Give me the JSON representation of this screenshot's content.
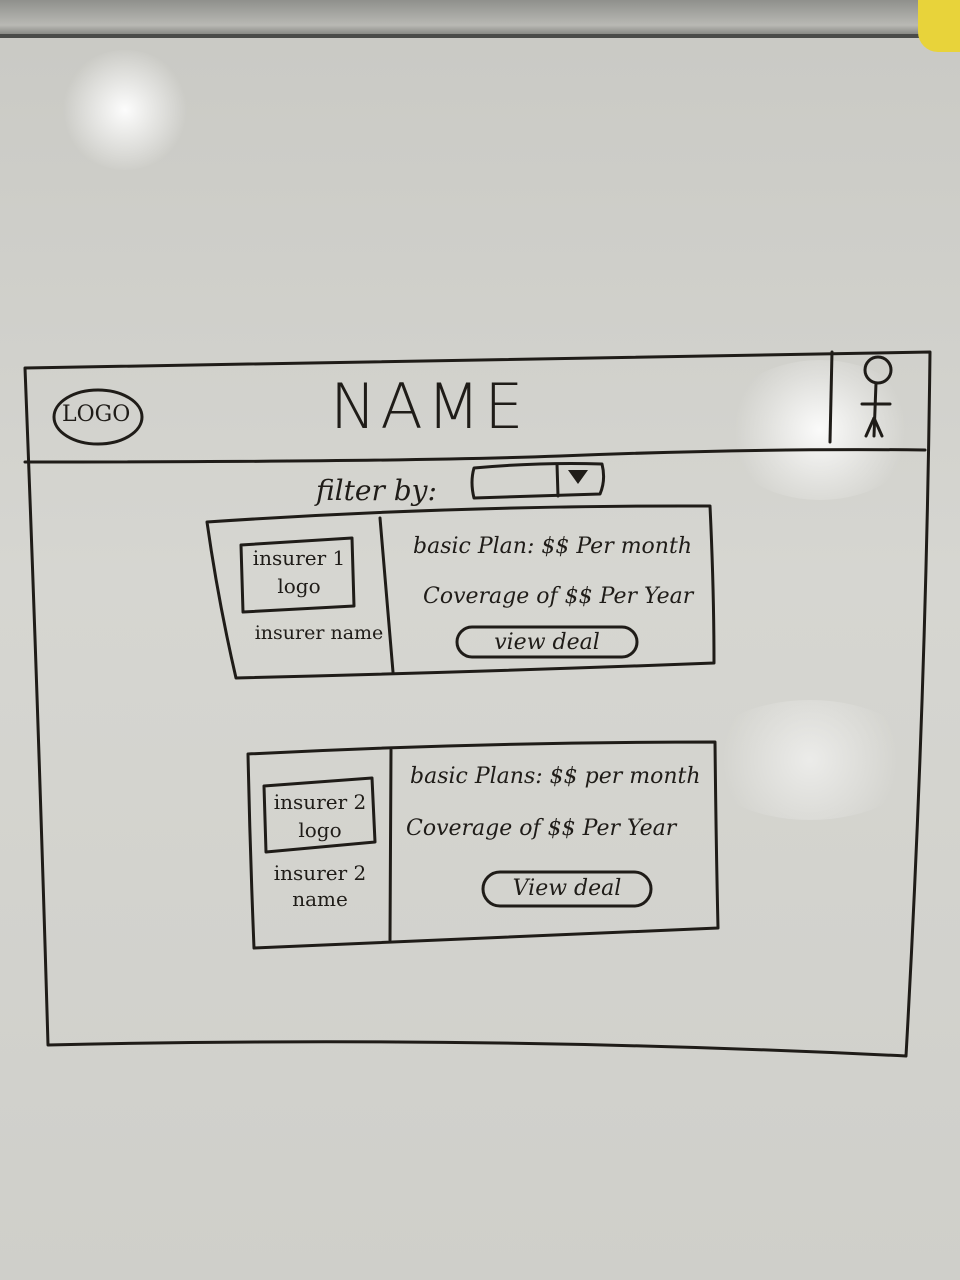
{
  "header": {
    "logo": "LOGO",
    "title": "NAME",
    "profile_icon": "stick-figure-user-icon"
  },
  "filter": {
    "label": "filter by:",
    "value": "",
    "dropdown_icon": "dropdown-arrow-icon"
  },
  "deals": [
    {
      "logo": "insurer 1 logo",
      "name": "insurer name",
      "plan": "basic Plan: $$ Per month",
      "coverage": "Coverage of $$ Per Year",
      "button": "view deal"
    },
    {
      "logo": "insurer 2 logo",
      "name": "insurer 2 name",
      "plan": "basic Plans: $$ per month",
      "coverage": "Coverage of $$ Per Year",
      "button": "View deal"
    }
  ]
}
